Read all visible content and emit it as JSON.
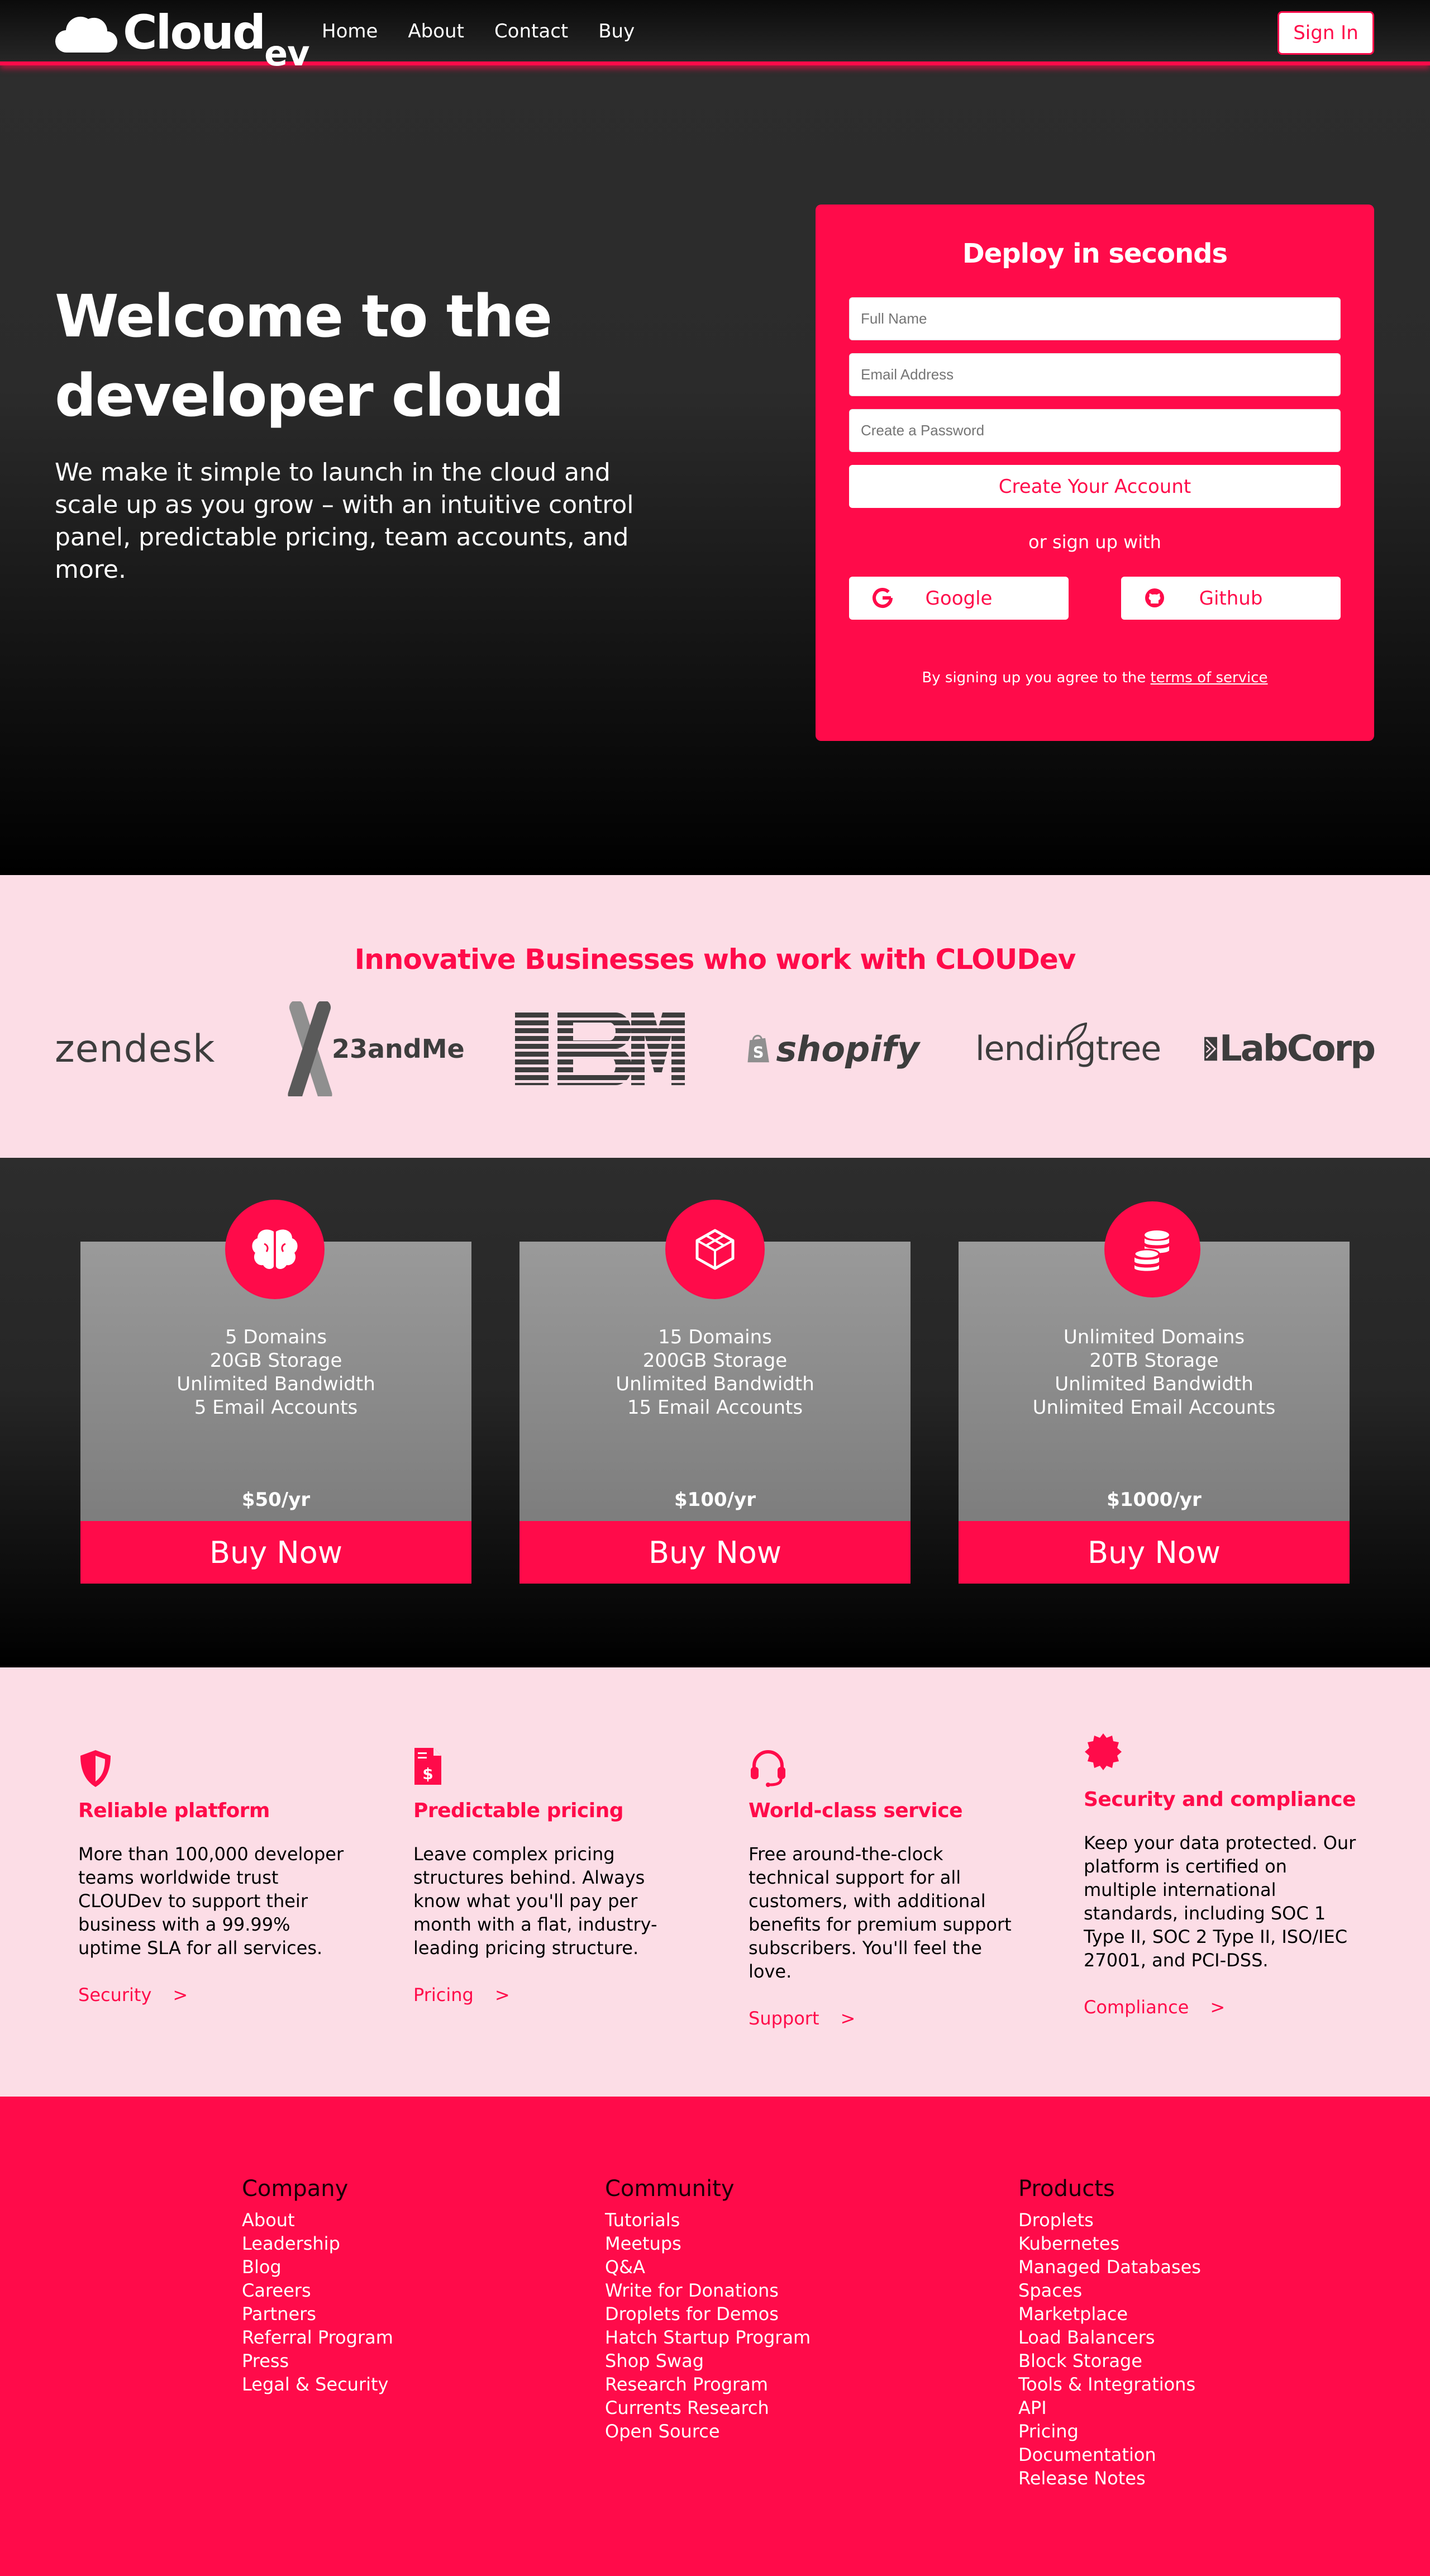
{
  "nav": {
    "logo_main": "Cloud",
    "logo_sub": "ev",
    "links": [
      "Home",
      "About",
      "Contact",
      "Buy"
    ],
    "signin_label": "Sign In"
  },
  "hero": {
    "title": "Welcome to the developer cloud",
    "subtitle": "We make it simple to launch in the cloud and scale up as you grow – with an intuitive control panel, predictable pricing, team accounts, and more."
  },
  "signup": {
    "title": "Deploy in seconds",
    "name_placeholder": "Full Name",
    "email_placeholder": "Email Address",
    "password_placeholder": "Create a Password",
    "create_label": "Create Your Account",
    "or_text": "or sign up with",
    "google_label": "Google",
    "github_label": "Github",
    "tos_prefix": "By signing up you agree to the ",
    "tos_link": "terms of service"
  },
  "partners": {
    "title": "Innovative Businesses who work with CLOUDev",
    "logos": [
      "zendesk",
      "23andMe",
      "IBM",
      "shopify",
      "lendingtree",
      "LabCorp"
    ]
  },
  "plans": [
    {
      "icon": "brain-icon",
      "features": [
        "5 Domains",
        "20GB Storage",
        "Unlimited Bandwidth",
        "5 Email Accounts"
      ],
      "price": "$50/yr",
      "buy_label": "Buy Now"
    },
    {
      "icon": "cube-icon",
      "features": [
        "15 Domains",
        "200GB Storage",
        "Unlimited Bandwidth",
        "15 Email Accounts"
      ],
      "price": "$100/yr",
      "buy_label": "Buy Now"
    },
    {
      "icon": "database-icon",
      "features": [
        "Unlimited Domains",
        "20TB Storage",
        "Unlimited Bandwidth",
        "Unlimited Email Accounts"
      ],
      "price": "$1000/yr",
      "buy_label": "Buy Now"
    }
  ],
  "features": [
    {
      "icon": "shield-icon",
      "title": "Reliable platform",
      "text": "More than 100,000 developer teams worldwide trust CLOUDev to support their business with a 99.99% uptime SLA for all services.",
      "link": "Security",
      "arrow": ">"
    },
    {
      "icon": "invoice-icon",
      "title": "Predictable pricing",
      "text": "Leave complex pricing structures behind. Always know what you'll pay per month with a flat, industry-leading pricing structure.",
      "link": "Pricing",
      "arrow": ">"
    },
    {
      "icon": "headset-icon",
      "title": "World-class service",
      "text": "Free around-the-clock technical support for all customers, with additional benefits for premium support subscribers. You'll feel the love.",
      "link": "Support",
      "arrow": ">"
    },
    {
      "icon": "certificate-icon",
      "title": "Security and compliance",
      "text": "Keep your data protected. Our platform is certified on multiple international standards, including SOC 1 Type II, SOC 2 Type II, ISO/IEC 27001, and PCI-DSS.",
      "link": "Compliance",
      "arrow": ">"
    }
  ],
  "footer": {
    "columns": [
      {
        "title": "Company",
        "items": [
          "About",
          "Leadership",
          "Blog",
          "Careers",
          "Partners",
          "Referral Program",
          "Press",
          "Legal & Security"
        ]
      },
      {
        "title": "Community",
        "items": [
          "Tutorials",
          "Meetups",
          "Q&A",
          "Write for Donations",
          "Droplets for Demos",
          "Hatch Startup Program",
          "Shop Swag",
          "Research Program",
          "Currents Research",
          "Open Source"
        ]
      },
      {
        "title": "Products",
        "items": [
          "Droplets",
          "Kubernetes",
          "Managed Databases",
          "Spaces",
          "Marketplace",
          "Load Balancers",
          "Block Storage",
          "Tools & Integrations",
          "API",
          "Pricing",
          "Documentation",
          "Release Notes"
        ]
      }
    ]
  },
  "colors": {
    "accent": "#ff0b4a",
    "band": "#fcdde6",
    "dark": "#2d2d2d"
  }
}
